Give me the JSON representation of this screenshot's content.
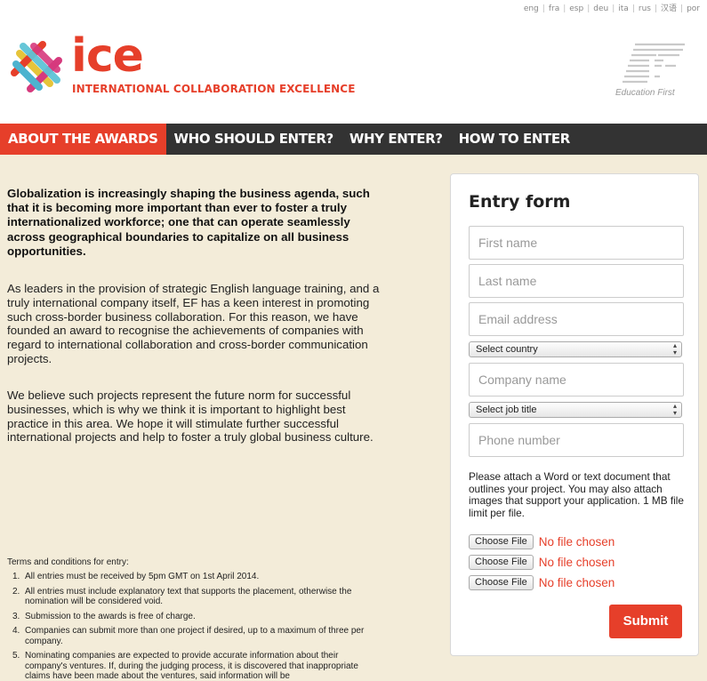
{
  "languages": [
    "eng",
    "fra",
    "esp",
    "deu",
    "ita",
    "rus",
    "汉语",
    "por"
  ],
  "brand": {
    "name": "ice",
    "tagline": "INTERNATIONAL COLLABORATION EXCELLENCE",
    "partner_caption": "Education First",
    "colors": {
      "accent": "#e63f2a",
      "nav_bg": "#333333",
      "page_bg": "#f3ecd9"
    }
  },
  "nav": [
    {
      "label": "ABOUT THE AWARDS",
      "active": true
    },
    {
      "label": "WHO SHOULD ENTER?",
      "active": false
    },
    {
      "label": "WHY ENTER?",
      "active": false
    },
    {
      "label": "HOW TO ENTER",
      "active": false
    }
  ],
  "content": {
    "lead": "Globalization is increasingly shaping the business agenda, such that it is becoming more important than ever to foster a truly internationalized workforce; one that can operate seamlessly across geographical boundaries to capitalize on all business opportunities.",
    "paragraph1": "As leaders in the provision of strategic English language training, and a truly international company itself, EF has a keen interest in promoting such cross-border business collaboration. For this reason, we have founded an award to recognise the achievements of companies with regard to international collaboration and cross-border communication projects.",
    "paragraph2": "We believe such projects represent the future norm for successful businesses, which is why we think it is important to highlight best practice in this area. We hope it will stimulate further successful international projects and help to foster a truly global business culture."
  },
  "terms": {
    "title": "Terms and conditions for entry:",
    "items": [
      {
        "num": "1.",
        "text": "All entries must be received by 5pm GMT on 1st April 2014."
      },
      {
        "num": "2.",
        "text": "All entries must include explanatory text that supports the placement, otherwise the nomination will be considered void."
      },
      {
        "num": "3.",
        "text": "Submission to the awards is free of charge."
      },
      {
        "num": "4.",
        "text": "Companies can submit more than one project if desired, up to a maximum of three per company."
      },
      {
        "num": "5.",
        "text": "Nominating companies are expected to provide accurate information about their company's ventures. If, during the judging process, it is discovered that inappropriate claims have been made about the ventures, said information will be"
      }
    ]
  },
  "form": {
    "title": "Entry form",
    "first_name_placeholder": "First name",
    "last_name_placeholder": "Last name",
    "email_placeholder": "Email address",
    "country_select": "Select country",
    "company_placeholder": "Company name",
    "job_select": "Select job title",
    "phone_placeholder": "Phone number",
    "help_text": "Please attach a Word or text document that outlines your project. You may also attach images that support your application. 1 MB file limit per file.",
    "file_inputs": [
      {
        "button": "Choose File",
        "status": "No file chosen"
      },
      {
        "button": "Choose File",
        "status": "No file chosen"
      },
      {
        "button": "Choose File",
        "status": "No file chosen"
      }
    ],
    "submit_label": "Submit"
  }
}
